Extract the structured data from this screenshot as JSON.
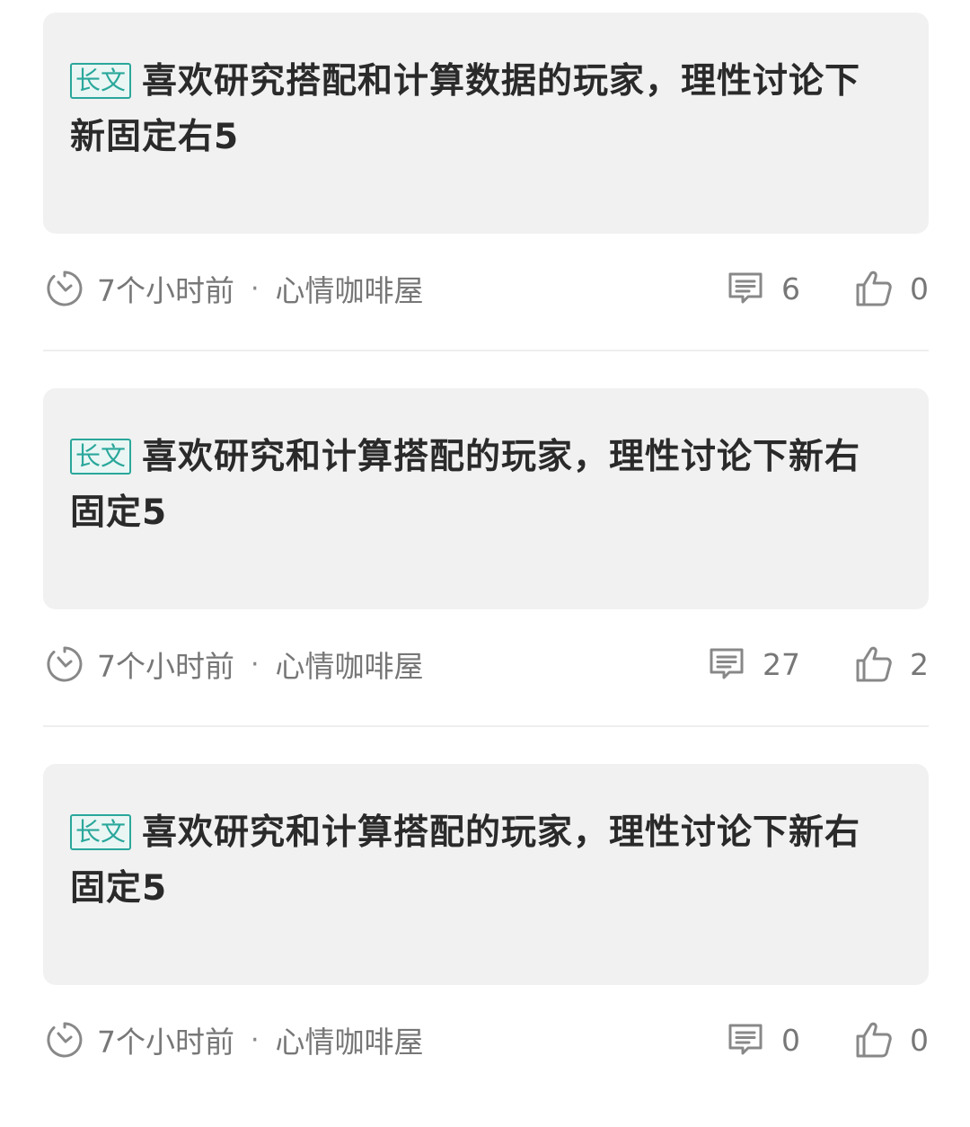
{
  "posts": [
    {
      "tag": "长文",
      "title": "喜欢研究搭配和计算数据的玩家，理性讨论下新固定右5",
      "time": "7个小时前",
      "separator": "·",
      "category": "心情咖啡屋",
      "comments": "6",
      "likes": "0"
    },
    {
      "tag": "长文",
      "title": "喜欢研究和计算搭配的玩家，理性讨论下新右固定5",
      "time": "7个小时前",
      "separator": "·",
      "category": "心情咖啡屋",
      "comments": "27",
      "likes": "2"
    },
    {
      "tag": "长文",
      "title": "喜欢研究和计算搭配的玩家，理性讨论下新右固定5",
      "time": "7个小时前",
      "separator": "·",
      "category": "心情咖啡屋",
      "comments": "0",
      "likes": "0"
    }
  ],
  "icons": {
    "time": "clock-icon",
    "comments": "comment-icon",
    "likes": "thumbs-up-icon"
  },
  "colors": {
    "card_background": "#f1f1f1",
    "tag_accent": "#2aa79b",
    "meta_text": "#777777",
    "title_text": "#2a2a2a"
  }
}
